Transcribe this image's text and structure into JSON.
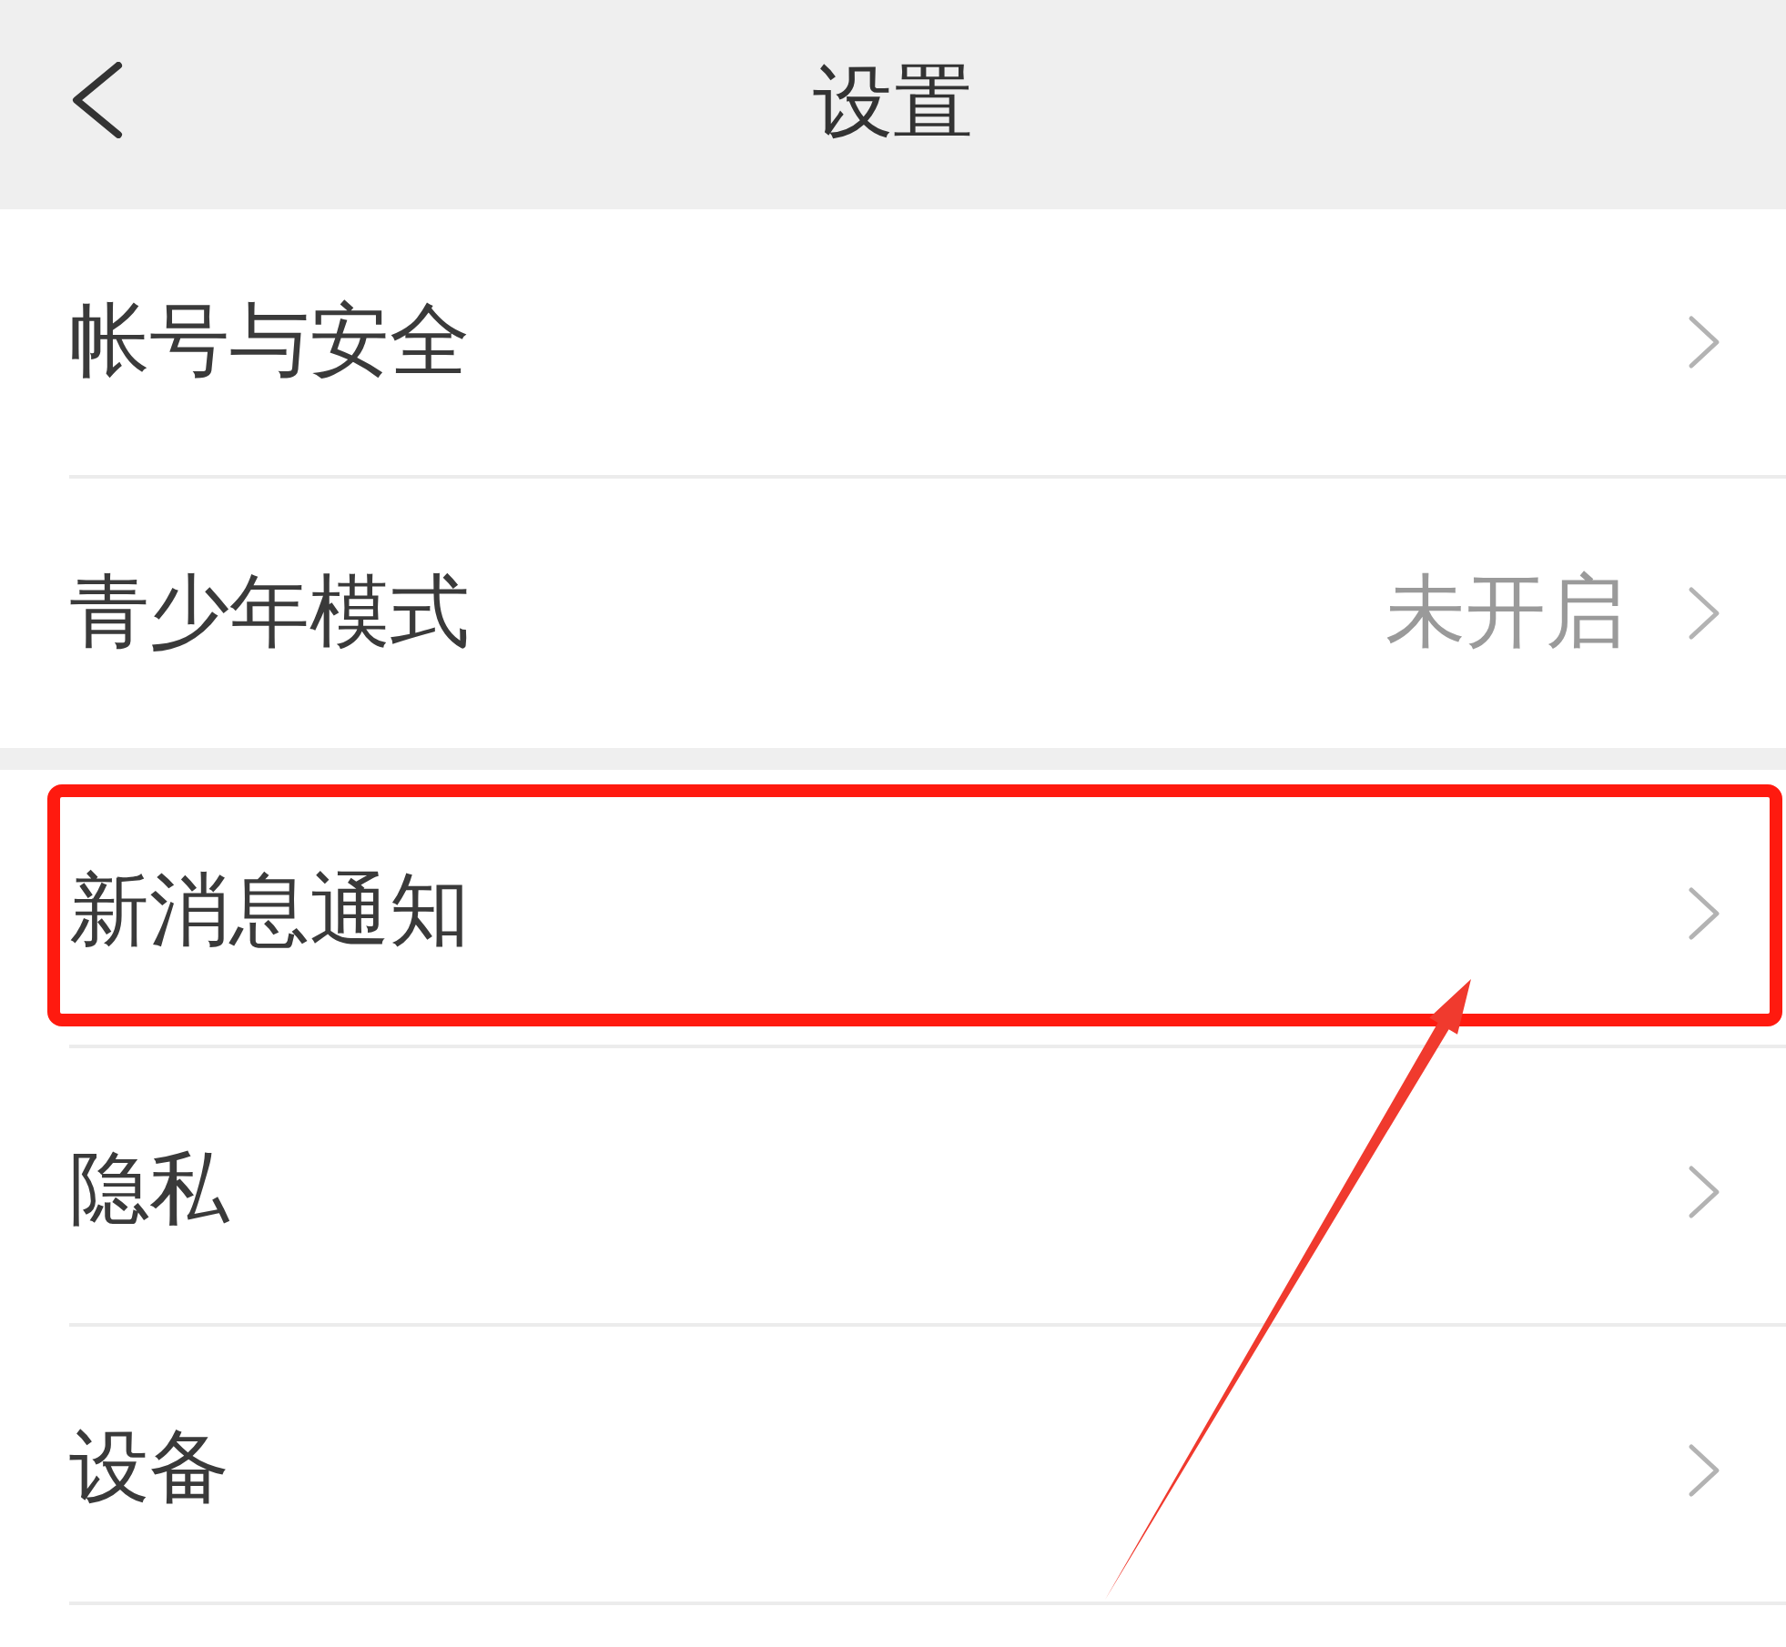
{
  "header": {
    "title": "设置"
  },
  "sections": [
    {
      "items": [
        {
          "label": "帐号与安全",
          "highlighted": false
        },
        {
          "label": "青少年模式",
          "value": "未开启",
          "highlighted": false
        }
      ]
    },
    {
      "items": [
        {
          "label": "新消息通知",
          "highlighted": true
        },
        {
          "label": "隐私",
          "highlighted": false
        },
        {
          "label": "设备",
          "highlighted": false
        }
      ]
    }
  ]
}
